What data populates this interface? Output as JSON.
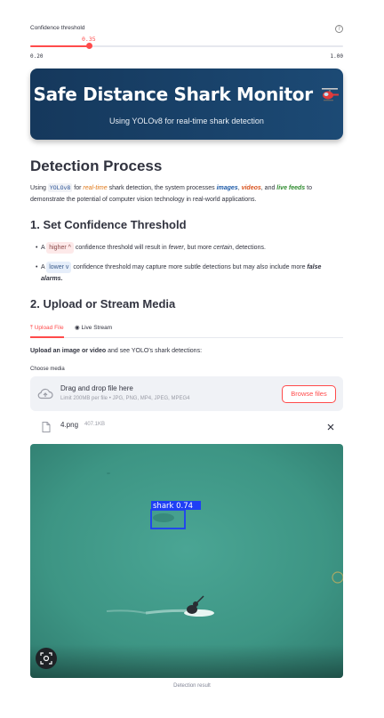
{
  "slider": {
    "label": "Confidence threshold",
    "value": "0.35",
    "min_label": "0.20",
    "max_label": "1.00",
    "min": 0.2,
    "max": 1.0,
    "current": 0.35,
    "help_icon": "question-circle-icon",
    "accent": "#ff4b4b"
  },
  "banner": {
    "title": "Safe Distance Shark Monitor",
    "title_icon": "helicopter-icon",
    "subtitle": "Using YOLOv8 for real-time shark detection"
  },
  "detection": {
    "heading": "Detection Process",
    "p_using": "Using ",
    "p_code": "YOLOv8",
    "p_for": " for ",
    "p_realtime": "real-time",
    "p_mid": " shark detection, the system processes ",
    "p_images": "images",
    "p_comma": ", ",
    "p_videos": "videos",
    "p_and": ", and ",
    "p_live": "live feeds",
    "p_end": " to demonstrate the potential of computer vision technology in real-world applications."
  },
  "section1": {
    "heading": "1. Set Confidence Threshold",
    "b1_a": "A ",
    "b1_pill": "higher",
    "b1_b": " confidence threshold will result in ",
    "b1_fewer": "fewer",
    "b1_c": ", but more ",
    "b1_certain": "certain",
    "b1_d": ", detections.",
    "b2_a": "A ",
    "b2_pill": "lower",
    "b2_b": " confidence threshold may capture more subtle detections but may ",
    "b2_also": "also",
    "b2_c": " include more ",
    "b2_false": "false alarms."
  },
  "section2": {
    "heading": "2. Upload or Stream Media",
    "tabs": [
      {
        "label": "Upload File",
        "icon": "upload-icon",
        "active": true
      },
      {
        "label": "Live Stream",
        "icon": "webcam-icon",
        "active": false
      }
    ],
    "intro_bold": "Upload an image or video",
    "intro_rest": " and see YOLO's shark detections:",
    "choose_label": "Choose media",
    "drop_title": "Drag and drop file here",
    "drop_limit": "Limit 200MB per file • JPG, PNG, MP4, JPEG, MPEG4",
    "browse_label": "Browse files",
    "file_name": "4.png",
    "file_size": "407.1KB",
    "detection_label": "shark 0.74",
    "caption": "Detection result"
  }
}
